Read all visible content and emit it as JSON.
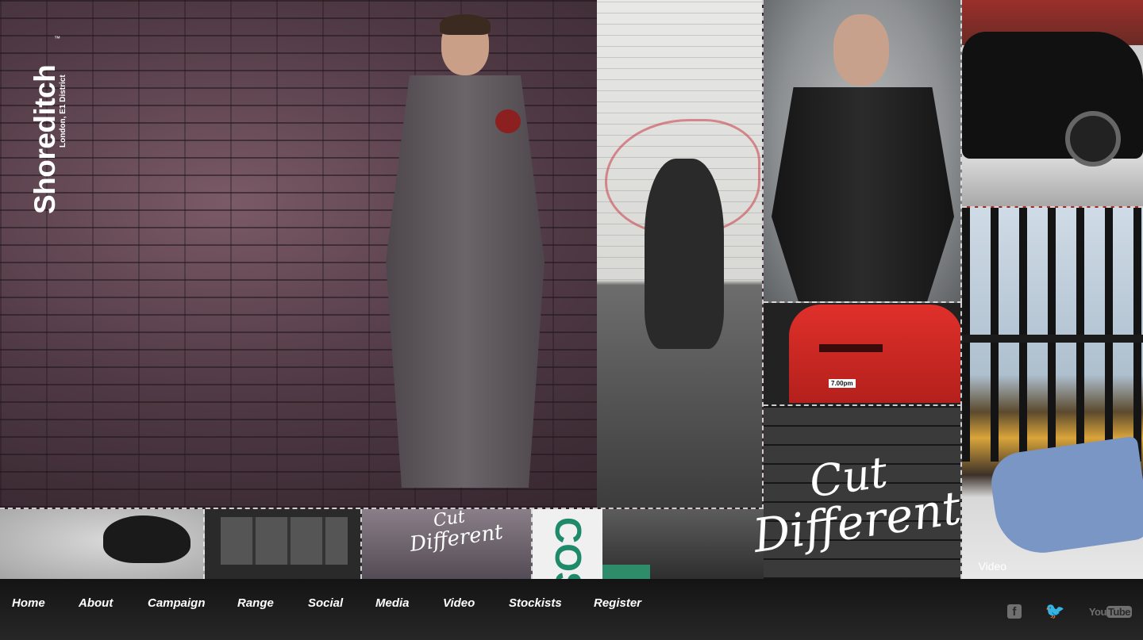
{
  "logo": {
    "brand": "Shoreditch",
    "tm": "™",
    "subtitle": "London, E1 District"
  },
  "hero": {
    "alt": "Model in grey suit holding an apple against brick wall"
  },
  "tiles": {
    "cut_different_line1": "Cut",
    "cut_different_line2": "Different",
    "video_label": "Video",
    "small_cut_line1": "Cut",
    "small_cut_line2": "Different",
    "cos_text": "COS",
    "postbox_sign": "7.00pm"
  },
  "nav": {
    "items": [
      {
        "label": "Home"
      },
      {
        "label": "About"
      },
      {
        "label": "Campaign"
      },
      {
        "label": "Range"
      },
      {
        "label": "Social"
      },
      {
        "label": "Media"
      },
      {
        "label": "Video"
      },
      {
        "label": "Stockists"
      },
      {
        "label": "Register"
      }
    ]
  },
  "social": {
    "facebook": "f",
    "twitter": "🐦",
    "youtube_you": "You",
    "youtube_tube": "Tube"
  }
}
